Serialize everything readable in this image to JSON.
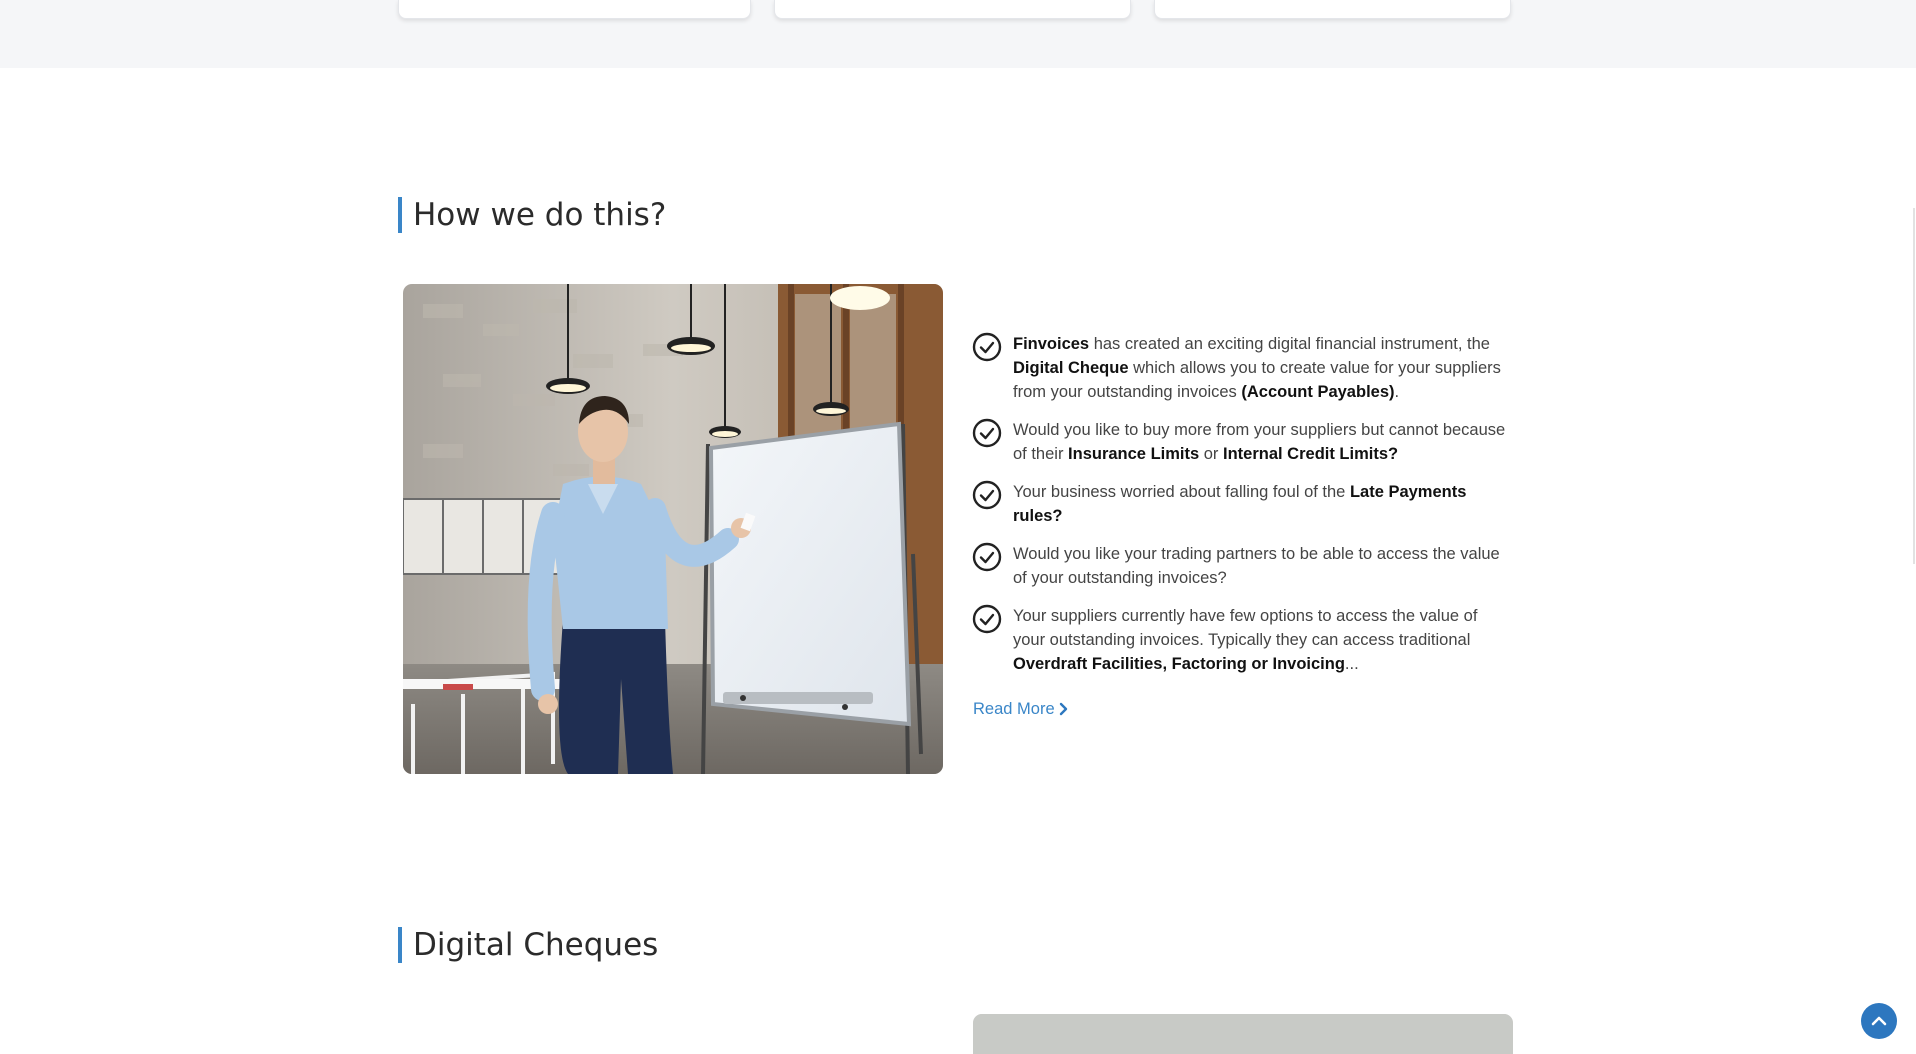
{
  "how_section": {
    "title": "How we do this?",
    "points": [
      [
        {
          "t": "Finvoices",
          "b": true
        },
        {
          "t": " has created an exciting digital financial instrument, the ",
          "b": false
        },
        {
          "t": "Digital Cheque",
          "b": true
        },
        {
          "t": " which allows you to create value for your suppliers from your outstanding invoices ",
          "b": false
        },
        {
          "t": "(Account Payables)",
          "b": true
        },
        {
          "t": ".",
          "b": false
        }
      ],
      [
        {
          "t": "Would you like to buy more from your suppliers but cannot because of their ",
          "b": false
        },
        {
          "t": "Insurance Limits",
          "b": true
        },
        {
          "t": " or ",
          "b": false
        },
        {
          "t": "Internal Credit Limits?",
          "b": true
        }
      ],
      [
        {
          "t": "Your business worried about falling foul of the ",
          "b": false
        },
        {
          "t": "Late Payments rules?",
          "b": true
        }
      ],
      [
        {
          "t": "Would you like your trading partners to be able to access the value of your outstanding invoices?",
          "b": false
        }
      ],
      [
        {
          "t": "Your suppliers currently have few options to access the value of your outstanding invoices. Typically they can access traditional ",
          "b": false
        },
        {
          "t": "Overdraft Facilities, Factoring or Invoicing",
          "b": true
        },
        {
          "t": "...",
          "b": false
        }
      ]
    ],
    "read_more": "Read More"
  },
  "cheques_section": {
    "title": "Digital Cheques"
  },
  "colors": {
    "accent": "#3a86c8",
    "scroll_button": "#2d77bf",
    "band": "#f5f6f8"
  },
  "icons": {
    "check": "check-circle-icon",
    "read_more": "chevron-right-icon",
    "scroll_top": "chevron-up-icon"
  }
}
